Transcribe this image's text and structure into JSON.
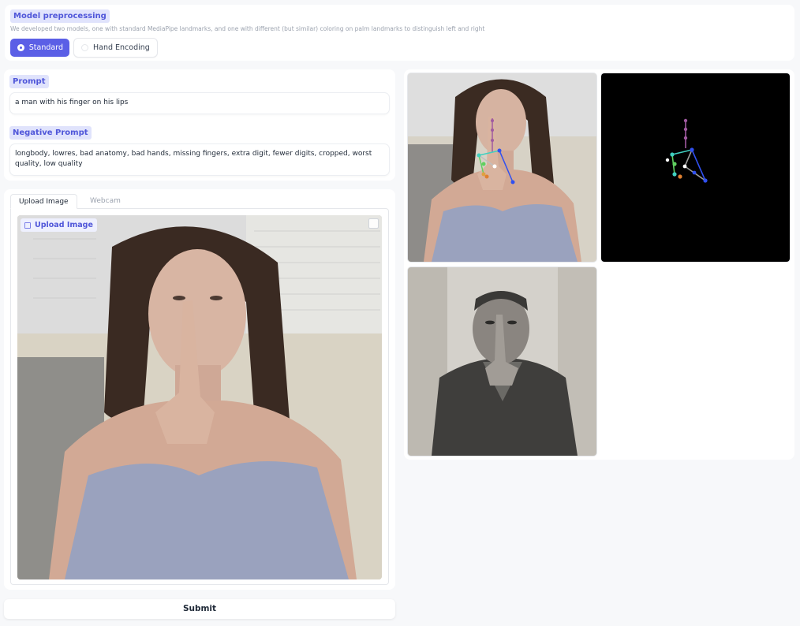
{
  "model": {
    "label": "Model preprocessing",
    "description": "We developed two models, one with standard MediaPipe landmarks, and one with different (but similar) coloring on palm landmarks to distinguish left and right",
    "options": [
      {
        "label": "Standard",
        "selected": true
      },
      {
        "label": "Hand Encoding",
        "selected": false
      }
    ]
  },
  "prompt": {
    "label": "Prompt",
    "value": "a man with his finger on his lips"
  },
  "negative_prompt": {
    "label": "Negative Prompt",
    "value": "longbody, lowres, bad anatomy, bad hands, missing fingers, extra digit, fewer digits, cropped, worst quality, low quality"
  },
  "input": {
    "tabs": [
      "Upload Image",
      "Webcam"
    ],
    "active_tab": "Upload Image",
    "image_label": "Upload Image"
  },
  "submit_label": "Submit",
  "gallery": {
    "images": [
      "input-photo-with-landmarks",
      "hand-landmark-skeleton",
      "generated-image"
    ]
  },
  "colors": {
    "accent": "#5b5fe6",
    "label_bg": "#e0e3fc",
    "label_text": "#4f56d9"
  }
}
